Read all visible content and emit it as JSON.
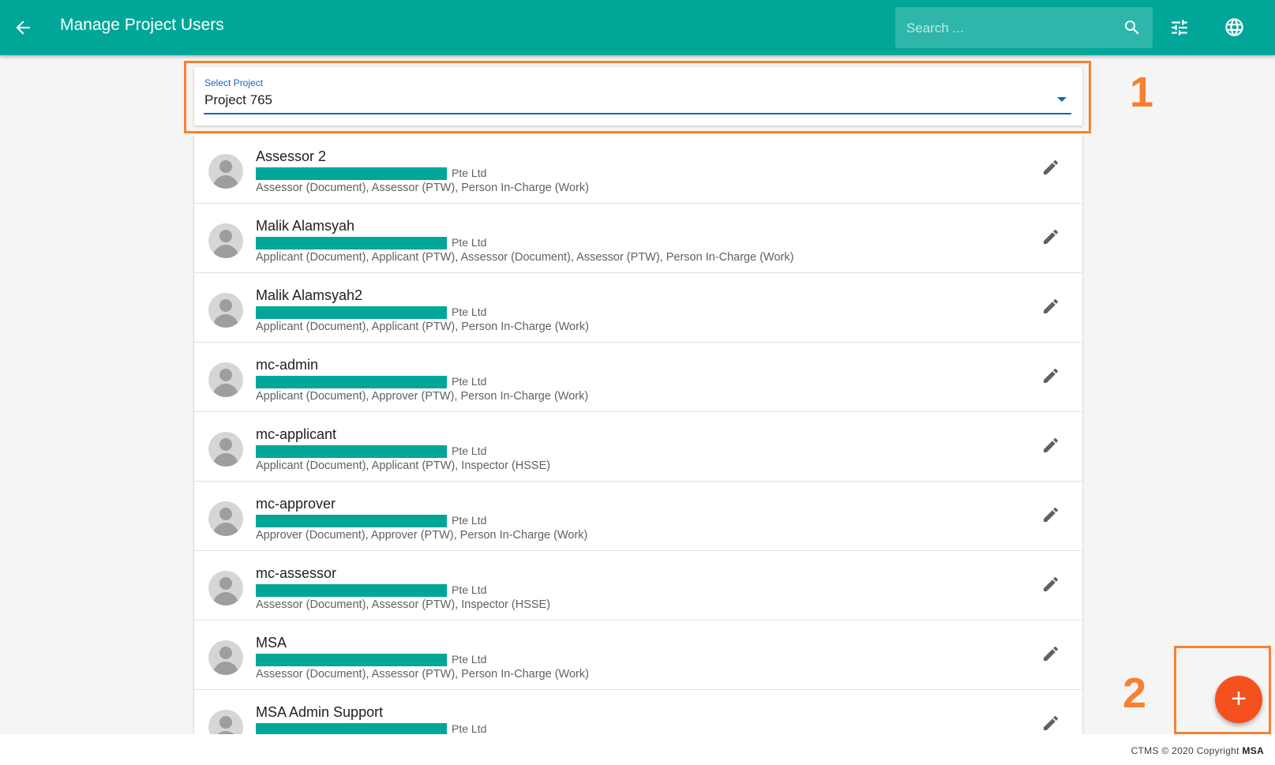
{
  "header": {
    "title": "Manage Project Users",
    "search_placeholder": "Search ...",
    "icons": [
      "arrow-back-icon",
      "search-icon",
      "tune-icon",
      "globe-icon"
    ],
    "accent_color": "#00a698"
  },
  "project_select": {
    "label": "Select Project",
    "value": "Project 765"
  },
  "annotations": {
    "one": "1",
    "two": "2",
    "color": "#f7812f"
  },
  "users": [
    {
      "name": "Assessor 2",
      "company": "Pte Ltd",
      "roles": "Assessor (Document), Assessor (PTW), Person In-Charge (Work)"
    },
    {
      "name": "Malik Alamsyah",
      "company": "Pte Ltd",
      "roles": "Applicant (Document), Applicant (PTW), Assessor (Document), Assessor (PTW), Person In-Charge (Work)"
    },
    {
      "name": "Malik Alamsyah2",
      "company": "Pte Ltd",
      "roles": "Applicant (Document), Applicant (PTW), Person In-Charge (Work)"
    },
    {
      "name": "mc-admin",
      "company": "Pte Ltd",
      "roles": "Applicant (Document), Approver (PTW), Person In-Charge (Work)"
    },
    {
      "name": "mc-applicant",
      "company": "Pte Ltd",
      "roles": "Applicant (Document), Applicant (PTW), Inspector (HSSE)"
    },
    {
      "name": "mc-approver",
      "company": "Pte Ltd",
      "roles": "Approver (Document), Approver (PTW), Person In-Charge (Work)"
    },
    {
      "name": "mc-assessor",
      "company": "Pte Ltd",
      "roles": "Assessor (Document), Assessor (PTW), Inspector (HSSE)"
    },
    {
      "name": "MSA",
      "company": "Pte Ltd",
      "roles": "Assessor (Document), Assessor (PTW), Person In-Charge (Work)"
    },
    {
      "name": "MSA Admin Support",
      "company": "Pte Ltd",
      "roles": ""
    }
  ],
  "fab": {
    "label": "+",
    "color": "#f4511e"
  },
  "footer": {
    "text": "CTMS © 2020 Copyright",
    "brand": "MSA"
  }
}
